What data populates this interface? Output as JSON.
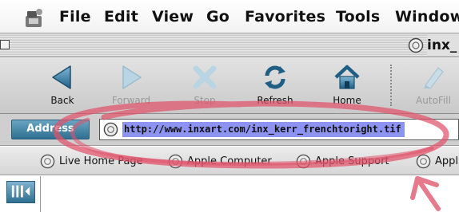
{
  "menubar": {
    "apple_icon": "apple-logo-icon",
    "items": [
      "File",
      "Edit",
      "View",
      "Go",
      "Favorites",
      "Tools",
      "Window"
    ]
  },
  "window": {
    "title": "inx_"
  },
  "toolbar": {
    "buttons": [
      {
        "label": "Back",
        "icon": "back-arrow-icon",
        "enabled": true
      },
      {
        "label": "Forward",
        "icon": "forward-arrow-icon",
        "enabled": false
      },
      {
        "label": "Stop",
        "icon": "stop-x-icon",
        "enabled": false
      },
      {
        "label": "Refresh",
        "icon": "refresh-icon",
        "enabled": true
      },
      {
        "label": "Home",
        "icon": "home-icon",
        "enabled": true
      },
      {
        "label": "AutoFill",
        "icon": "autofill-icon",
        "enabled": false
      }
    ]
  },
  "address": {
    "label": "Address",
    "url": "http://www.inxart.com/inx_kerr_frenchtoright.tif"
  },
  "favorites": {
    "items": [
      "Live Home Page",
      "Apple Computer",
      "Apple Support",
      "Appl"
    ]
  },
  "colors": {
    "annotation": "#e0536b",
    "url_highlight": "#8c93f0",
    "address_tab": "#2f6f91"
  }
}
